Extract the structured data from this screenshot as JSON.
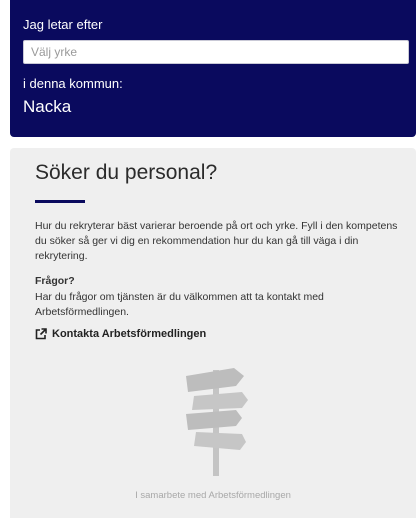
{
  "search": {
    "profession_label": "Jag letar efter",
    "profession_placeholder": "Välj yrke",
    "municipality_label": "i denna kommun:",
    "municipality_value": "Nacka"
  },
  "employer_card": {
    "heading": "Söker du personal?",
    "intro": "Hur du rekryterar bäst varierar beroende på ort och yrke. Fyll i den kompetens du söker så ger vi dig en rekommendation hur du kan gå till väga i din rekrytering.",
    "questions_heading": "Frågor?",
    "questions_text": "Har du frågor om tjänsten är du välkommen att ta kontakt med Arbetsförmedlingen.",
    "contact_link_label": "Kontakta Arbetsförmedlingen",
    "contact_link_icon": "external-link-icon",
    "illustration_icon": "signpost-icon",
    "partner_note": "I samarbete med Arbetsförmedlingen"
  },
  "colors": {
    "panel_background": "#0a0a5e",
    "card_background": "#efefef",
    "accent_rule": "#0a0a5e",
    "muted_text": "#a8a8a8"
  }
}
